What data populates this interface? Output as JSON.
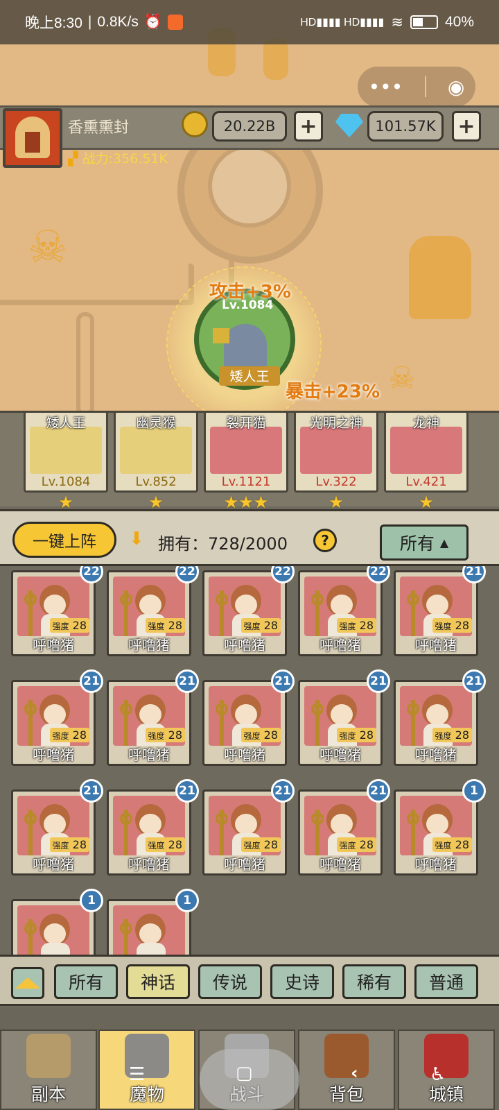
{
  "status_bar": {
    "time": "晚上8:30",
    "network_speed": "0.8K/s",
    "battery": "40%"
  },
  "miniprogram": {
    "menu_icon": "more-dots-icon",
    "close_icon": "close-circle-icon"
  },
  "player": {
    "name": "香熏熏封",
    "gold": "20.22B",
    "gems": "101.57K",
    "power": "战力:356.51K"
  },
  "center_hero": {
    "level": "Lv.1084",
    "name": "矮人王",
    "buff_attack": "攻击+3%",
    "buff_crit": "暴击+23%"
  },
  "team": [
    {
      "name": "矮人王",
      "level": "Lv.1084",
      "stars": "★",
      "color": "#e6cf7a"
    },
    {
      "name": "幽灵猴",
      "level": "Lv.852",
      "stars": "★",
      "color": "#e6cf7a"
    },
    {
      "name": "裂开猫",
      "level": "Lv.1121",
      "stars": "★★★",
      "color": "#d9787a"
    },
    {
      "name": "光明之神",
      "level": "Lv.322",
      "stars": "★",
      "color": "#d9787a"
    },
    {
      "name": "龙神",
      "level": "Lv.421",
      "stars": "★",
      "color": "#d9787a"
    }
  ],
  "toolbar": {
    "deploy_label": "一键上阵",
    "owned": "拥有：728/2000",
    "filter_label": "所有"
  },
  "monsters": [
    {
      "name": "呼噜猪",
      "strength_label": "强度",
      "strength": "28",
      "count": "22"
    },
    {
      "name": "呼噜猪",
      "strength_label": "强度",
      "strength": "28",
      "count": "22"
    },
    {
      "name": "呼噜猪",
      "strength_label": "强度",
      "strength": "28",
      "count": "22"
    },
    {
      "name": "呼噜猪",
      "strength_label": "强度",
      "strength": "28",
      "count": "22"
    },
    {
      "name": "呼噜猪",
      "strength_label": "强度",
      "strength": "28",
      "count": "21"
    },
    {
      "name": "呼噜猪",
      "strength_label": "强度",
      "strength": "28",
      "count": "21"
    },
    {
      "name": "呼噜猪",
      "strength_label": "强度",
      "strength": "28",
      "count": "21"
    },
    {
      "name": "呼噜猪",
      "strength_label": "强度",
      "strength": "28",
      "count": "21"
    },
    {
      "name": "呼噜猪",
      "strength_label": "强度",
      "strength": "28",
      "count": "21"
    },
    {
      "name": "呼噜猪",
      "strength_label": "强度",
      "strength": "28",
      "count": "21"
    },
    {
      "name": "呼噜猪",
      "strength_label": "强度",
      "strength": "28",
      "count": "21"
    },
    {
      "name": "呼噜猪",
      "strength_label": "强度",
      "strength": "28",
      "count": "21"
    },
    {
      "name": "呼噜猪",
      "strength_label": "强度",
      "strength": "28",
      "count": "21"
    },
    {
      "name": "呼噜猪",
      "strength_label": "强度",
      "strength": "28",
      "count": "21"
    },
    {
      "name": "呼噜猪",
      "strength_label": "强度",
      "strength": "28",
      "count": "1"
    },
    {
      "name": "",
      "strength_label": "",
      "strength": "",
      "count": "1"
    },
    {
      "name": "",
      "strength_label": "",
      "strength": "",
      "count": "1"
    }
  ],
  "rarity_tabs": [
    "所有",
    "神话",
    "传说",
    "史诗",
    "稀有",
    "普通"
  ],
  "active_rarity_index": 1,
  "nav": [
    {
      "label": "副本",
      "icon": "map-icon"
    },
    {
      "label": "魔物",
      "icon": "monster-helmet-icon"
    },
    {
      "label": "战斗",
      "icon": "crossed-swords-icon"
    },
    {
      "label": "背包",
      "icon": "backpack-icon"
    },
    {
      "label": "城镇",
      "icon": "town-icon"
    }
  ],
  "active_nav_index": 1
}
